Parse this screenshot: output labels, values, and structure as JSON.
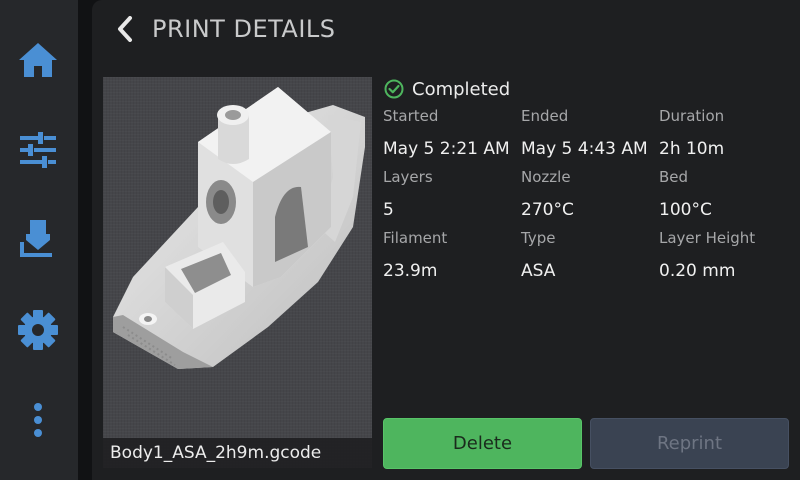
{
  "header": {
    "title": "PRINT DETAILS"
  },
  "status": {
    "label": "Completed",
    "color": "#4eb55e"
  },
  "details": [
    {
      "label": "Started",
      "value": "May 5 2:21 AM"
    },
    {
      "label": "Ended",
      "value": "May 5 4:43 AM"
    },
    {
      "label": "Duration",
      "value": "2h 10m"
    },
    {
      "label": "Layers",
      "value": "5"
    },
    {
      "label": "Nozzle",
      "value": "270°C"
    },
    {
      "label": "Bed",
      "value": "100°C"
    },
    {
      "label": "Filament",
      "value": "23.9m"
    },
    {
      "label": "Type",
      "value": "ASA"
    },
    {
      "label": "Layer Height",
      "value": "0.20 mm"
    }
  ],
  "thumbnail": {
    "filename": "Body1_ASA_2h9m.gcode"
  },
  "actions": {
    "delete_label": "Delete",
    "reprint_label": "Reprint"
  },
  "sidebar": {
    "items": [
      {
        "icon": "home-icon"
      },
      {
        "icon": "sliders-icon"
      },
      {
        "icon": "extruder-icon"
      },
      {
        "icon": "gear-icon"
      },
      {
        "icon": "more-vertical-icon"
      }
    ]
  },
  "colors": {
    "accent": "#4a8fd4",
    "delete": "#4eb55e",
    "reprint": "#3a4352"
  }
}
